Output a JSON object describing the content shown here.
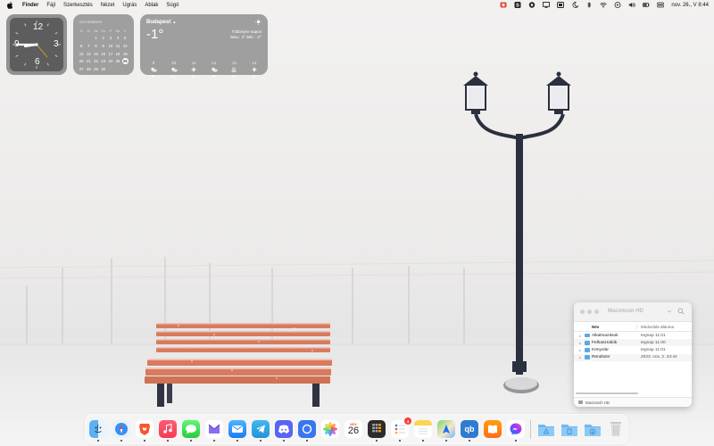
{
  "menubar": {
    "app_name": "Finder",
    "items": [
      "Fájl",
      "Szerkesztés",
      "Nézet",
      "Ugrás",
      "Ablak",
      "Súgó"
    ],
    "status_icons": [
      "vpn-icon",
      "app-s-icon",
      "record-icon",
      "display-icon",
      "moon-icon",
      "bluetooth-icon",
      "wifi-icon",
      "play-icon",
      "volume-icon",
      "battery-icon",
      "control-center-icon"
    ],
    "clock": "nov. 26., V  8:44"
  },
  "widgets": {
    "clock": {
      "numerals": [
        "12",
        "3",
        "6",
        "9"
      ],
      "time_shown": "8:44"
    },
    "calendar": {
      "month": "NOVEMBER",
      "weekdays": [
        "H",
        "K",
        "Sz",
        "Cs",
        "P",
        "Sz",
        "V"
      ],
      "weeks": [
        [
          "",
          "",
          "1",
          "2",
          "3",
          "4",
          "5"
        ],
        [
          "6",
          "7",
          "8",
          "9",
          "10",
          "11",
          "12"
        ],
        [
          "13",
          "14",
          "15",
          "16",
          "17",
          "18",
          "19"
        ],
        [
          "20",
          "21",
          "22",
          "23",
          "24",
          "25",
          "26"
        ],
        [
          "27",
          "28",
          "29",
          "30",
          "",
          "",
          ""
        ]
      ],
      "today": "26"
    },
    "weather": {
      "city": "Budapest",
      "temperature": "-1°",
      "condition": "Többnyire napos",
      "range": "Max.: 3° Min.: -2°",
      "hourly": [
        {
          "hour": "9",
          "icon": "partly-cloudy-icon",
          "temp": "0°"
        },
        {
          "hour": "10",
          "icon": "partly-cloudy-icon",
          "temp": "1°"
        },
        {
          "hour": "11",
          "icon": "sun-icon",
          "temp": "2°"
        },
        {
          "hour": "12",
          "icon": "partly-cloudy-icon",
          "temp": "3°"
        },
        {
          "hour": "13",
          "icon": "sun-haze-icon",
          "temp": "3°"
        },
        {
          "hour": "14",
          "icon": "sun-icon",
          "temp": "3°"
        }
      ]
    }
  },
  "finder": {
    "title": "Macintosh HD",
    "columns": {
      "name": "Név",
      "modified": "Módosítás dátuma"
    },
    "rows": [
      {
        "name": "Alkalmazások",
        "modified": "tegnap 11:01"
      },
      {
        "name": "Felhasználók",
        "modified": "tegnap 11:00"
      },
      {
        "name": "Könyvtár",
        "modified": "tegnap 11:01"
      },
      {
        "name": "Rendszer",
        "modified": "2023. nov. 2. 23:44"
      }
    ],
    "path": "Macintosh HD"
  },
  "dock": {
    "calendar_month": "NOV",
    "calendar_day": "26",
    "reminders_badge": "4",
    "apps": [
      "Finder",
      "Safari",
      "Brave",
      "Music",
      "Messages",
      "Proton Mail",
      "Mail",
      "Telegram",
      "Discord",
      "Signal",
      "Photos",
      "Calendar",
      "Calculator",
      "Reminders",
      "Notes",
      "Maps",
      "qBittorrent",
      "Books",
      "Messenger",
      "Applications",
      "Documents",
      "Downloads",
      "Trash"
    ],
    "qb_label": "qb"
  },
  "colors": {
    "bench": "#d97a5e",
    "lamp": "#2a2f3f",
    "widget_bg": "#8a8a8a",
    "finder_folder": "#5aa9e6"
  }
}
